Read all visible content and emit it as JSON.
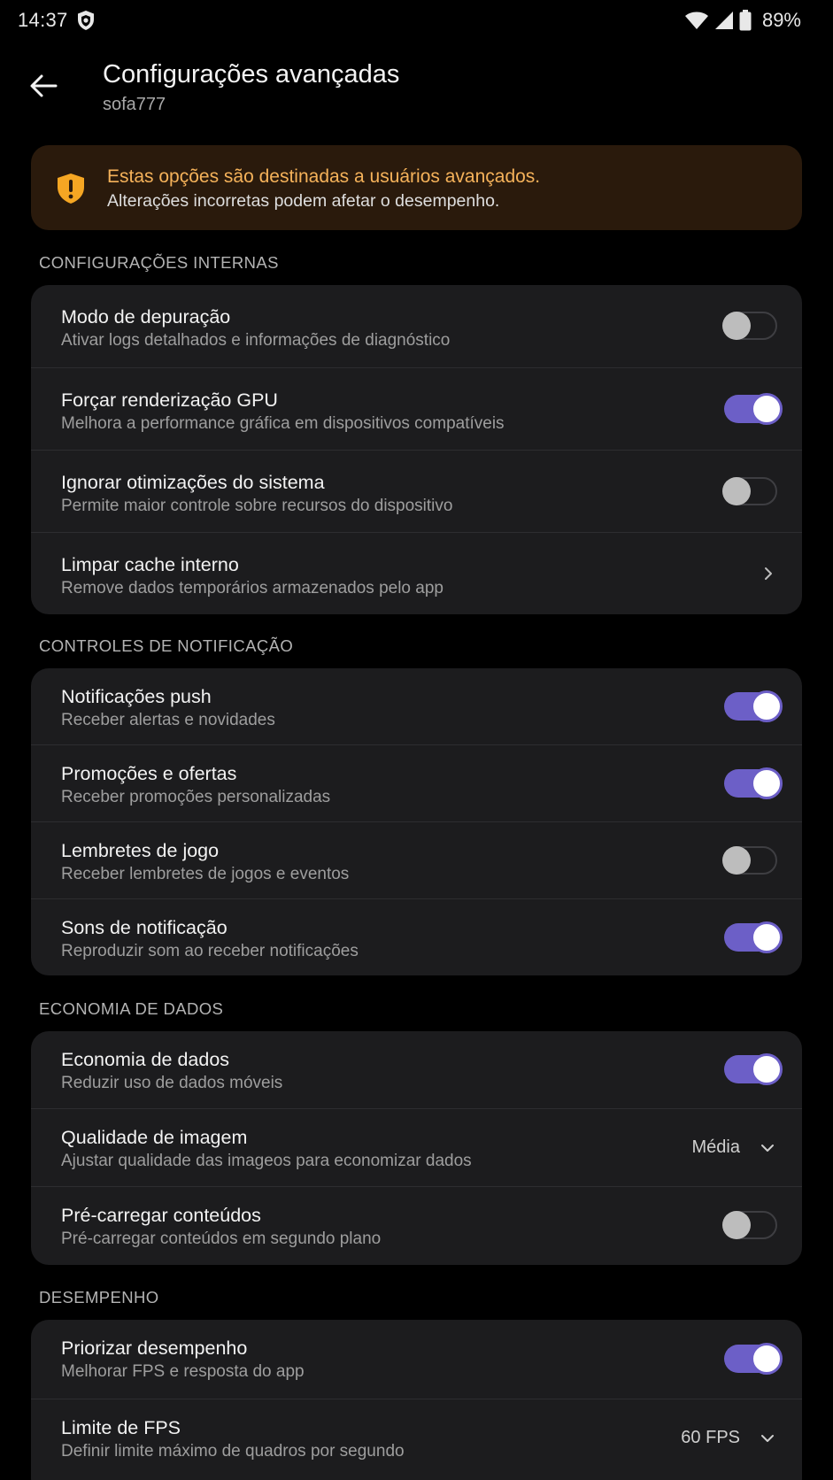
{
  "status_bar": {
    "time": "14:37",
    "battery": "89%"
  },
  "header": {
    "title": "Configurações avançadas",
    "subtitle": "sofa777"
  },
  "warning": {
    "title": "Estas opções são destinadas a usuários avançados.",
    "text": "Alterações incorretas podem afetar o desempenho."
  },
  "sections": [
    {
      "header": "CONFIGURAÇÕES INTERNAS",
      "rows": [
        {
          "title": "Modo de depuração",
          "subtitle": "Ativar logs detalhados e informações de diagnóstico",
          "control": "toggle",
          "on": false
        },
        {
          "title": "Forçar renderização GPU",
          "subtitle": "Melhora a performance gráfica em dispositivos compatíveis",
          "control": "toggle",
          "on": true
        },
        {
          "title": "Ignorar otimizações do sistema",
          "subtitle": "Permite maior controle sobre recursos do dispositivo",
          "control": "toggle",
          "on": false
        },
        {
          "title": "Limpar cache interno",
          "subtitle": "Remove dados temporários armazenados pelo app",
          "control": "chevron"
        }
      ]
    },
    {
      "header": "CONTROLES DE NOTIFICAÇÃO",
      "rows": [
        {
          "title": "Notificações push",
          "subtitle": "Receber alertas e novidades",
          "control": "toggle",
          "on": true
        },
        {
          "title": "Promoções e ofertas",
          "subtitle": "Receber promoções personalizadas",
          "control": "toggle",
          "on": true
        },
        {
          "title": "Lembretes de jogo",
          "subtitle": "Receber lembretes de jogos e eventos",
          "control": "toggle",
          "on": false
        },
        {
          "title": "Sons de notificação",
          "subtitle": "Reproduzir som ao receber notificações",
          "control": "toggle",
          "on": true
        }
      ]
    },
    {
      "header": "ECONOMIA DE DADOS",
      "rows": [
        {
          "title": "Economia de dados",
          "subtitle": "Reduzir uso de dados móveis",
          "control": "toggle",
          "on": true
        },
        {
          "title": "Qualidade de imagem",
          "subtitle": "Ajustar qualidade das imageos para economizar dados",
          "control": "select",
          "value": "Média"
        },
        {
          "title": "Pré-carregar conteúdos",
          "subtitle": "Pré-carregar conteúdos em segundo plano",
          "control": "toggle",
          "on": false
        }
      ]
    },
    {
      "header": "DESEMPENHO",
      "rows": [
        {
          "title": "Priorizar desempenho",
          "subtitle": "Melhorar FPS e resposta do app",
          "control": "toggle",
          "on": true
        },
        {
          "title": "Limite de FPS",
          "subtitle": "Definir limite máximo de quadros por segundo",
          "control": "select",
          "value": "60 FPS"
        }
      ]
    }
  ],
  "colors": {
    "accent": "#6c5fc7",
    "warning": "#f5b25a",
    "card": "#1c1c1e",
    "background": "#000000"
  },
  "icons": {
    "status": [
      "shield-icon",
      "wifi-icon",
      "signal-icon",
      "battery-icon"
    ],
    "back": "back-arrow-icon",
    "warning": "warning-shield-icon"
  }
}
